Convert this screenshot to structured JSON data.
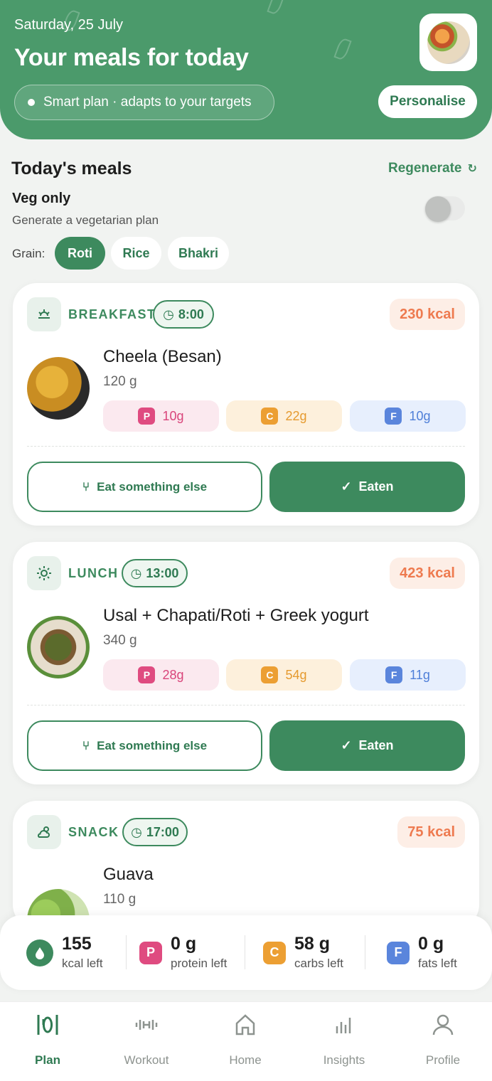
{
  "header": {
    "date": "Saturday, 25 July",
    "title": "Your meals for today",
    "smart_chip": "Smart plan · adapts to your targets",
    "personalise": "Personalise"
  },
  "meals_section": {
    "title": "Today's meals",
    "regenerate": "Regenerate",
    "veg_title": "Veg only",
    "veg_subtitle": "Generate a vegetarian plan",
    "veg_enabled": false,
    "grain_label": "Grain:",
    "grains": [
      "Roti",
      "Rice",
      "Bhakri"
    ],
    "grain_selected": "Roti"
  },
  "meals": [
    {
      "name": "BREAKFAST",
      "icon": "sunrise-icon",
      "time": "8:00",
      "kcal": "230 kcal",
      "food": "Cheela (Besan)",
      "weight": "120 g",
      "protein": "10g",
      "carbs": "22g",
      "fats": "10g",
      "else_label": "Eat something else",
      "eaten_label": "Eaten"
    },
    {
      "name": "LUNCH",
      "icon": "sun-icon",
      "time": "13:00",
      "kcal": "423 kcal",
      "food": "Usal + Chapati/Roti + Greek yogurt",
      "weight": "340 g",
      "protein": "28g",
      "carbs": "54g",
      "fats": "11g",
      "else_label": "Eat something else",
      "eaten_label": "Eaten"
    },
    {
      "name": "SNACK",
      "icon": "partly-cloudy-icon",
      "time": "17:00",
      "kcal": "75 kcal",
      "food": "Guava",
      "weight": "110 g"
    }
  ],
  "macro_letters": {
    "p": "P",
    "c": "C",
    "f": "F"
  },
  "summary": {
    "kcal_value": "155",
    "kcal_label": "kcal left",
    "protein_value": "0 g",
    "protein_label": "protein left",
    "carbs_value": "58 g",
    "carbs_label": "carbs left",
    "fats_value": "0 g",
    "fats_label": "fats left"
  },
  "tabs": [
    {
      "label": "Plan",
      "icon": "plan-utensils-icon",
      "active": true
    },
    {
      "label": "Workout",
      "icon": "dumbbell-icon",
      "active": false
    },
    {
      "label": "Home",
      "icon": "home-icon",
      "active": false
    },
    {
      "label": "Insights",
      "icon": "bar-chart-icon",
      "active": false
    },
    {
      "label": "Profile",
      "icon": "person-icon",
      "active": false
    }
  ],
  "colors": {
    "brand_green": "#4b9a6b",
    "button_green": "#3d8a5e",
    "kcal_orange": "#ee7a4f",
    "protein_pink": "#df4b80",
    "carbs_orange": "#ec9f33",
    "fats_blue": "#5a85dc"
  }
}
